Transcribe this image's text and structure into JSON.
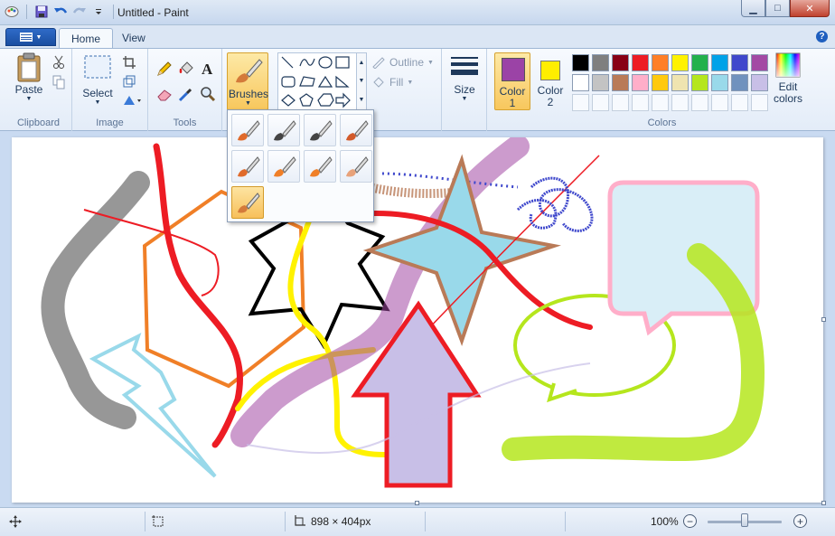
{
  "window": {
    "title": "Untitled - Paint",
    "controls": {
      "minimize": "▁",
      "maximize": "□",
      "close": "✕"
    }
  },
  "tabs": [
    {
      "label": "Home",
      "active": true
    },
    {
      "label": "View",
      "active": false
    }
  ],
  "ribbon": {
    "clipboard": {
      "label": "Clipboard",
      "paste": "Paste"
    },
    "image": {
      "label": "Image",
      "select": "Select"
    },
    "tools": {
      "label": "Tools"
    },
    "brushes": {
      "label": "Brushes"
    },
    "shapes": {
      "outline": "Outline",
      "fill": "Fill"
    },
    "size": {
      "label": "Size"
    },
    "colors": {
      "label": "Colors",
      "color1_label": "Color",
      "color1_num": "1",
      "color2_label": "Color",
      "color2_num": "2",
      "color1_value": "#9b43a6",
      "color2_value": "#ffee00",
      "edit_label": "Edit",
      "edit_label2": "colors",
      "palette_row1": [
        "#000000",
        "#7f7f7f",
        "#880015",
        "#ed1c24",
        "#ff7f27",
        "#fff200",
        "#22b14c",
        "#00a2e8",
        "#3f48cc",
        "#a349a4"
      ],
      "palette_row2": [
        "#ffffff",
        "#c3c3c3",
        "#b97a57",
        "#ffaec9",
        "#ffc90e",
        "#efe4b0",
        "#b5e61d",
        "#99d9ea",
        "#7092be",
        "#c8bfe7"
      ]
    }
  },
  "brushes_menu": {
    "items": [
      "brush",
      "calligraphy-brush-1",
      "calligraphy-brush-2",
      "airbrush",
      "oil-brush",
      "crayon",
      "marker",
      "natural-pencil",
      "watercolor-brush"
    ],
    "selected_index": 8
  },
  "statusbar": {
    "dimensions": "898 × 404px",
    "zoom": "100%",
    "zoom_minus": "−",
    "zoom_plus": "+"
  }
}
